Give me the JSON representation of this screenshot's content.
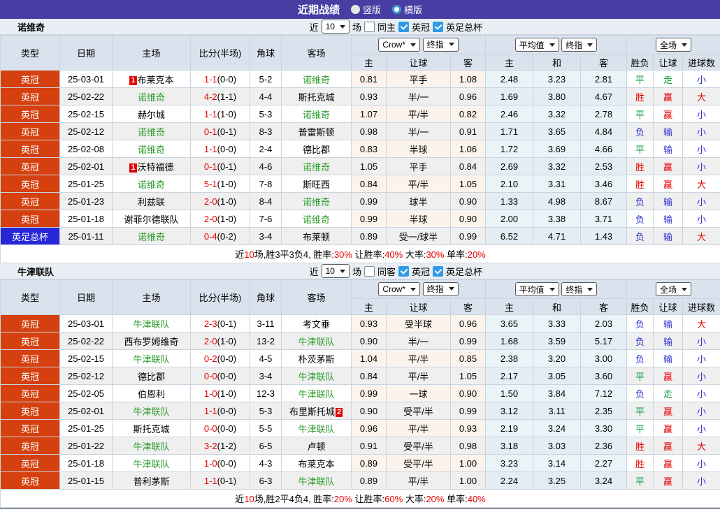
{
  "header": {
    "title": "近期战绩",
    "vertical_label": "竖版",
    "horizontal_label": "横版"
  },
  "controls": {
    "recent_label": "近",
    "games": "10",
    "games_label": "场",
    "league1": "英冠",
    "league2": "英足总杯",
    "odds_source": "Crow*",
    "odds_final": "终指",
    "avg_source": "平均值",
    "avg_final": "终指",
    "scope": "全场"
  },
  "columns": {
    "type": "类型",
    "date": "日期",
    "home": "主场",
    "score": "比分(半场)",
    "corner": "角球",
    "away": "客场",
    "odds_home": "主",
    "odds_handicap": "让球",
    "odds_away": "客",
    "avg_home": "主",
    "avg_draw": "和",
    "avg_away": "客",
    "result_wdl": "胜负",
    "result_handicap": "让球",
    "result_goals": "进球数"
  },
  "colors": {
    "accent_purple": "#473da3",
    "league_red": "#d5400e",
    "cup_blue": "#2727d8",
    "team_green": "#2f9e2f",
    "win_red": "#e60000",
    "loss_blue": "#2f2fd0",
    "draw_green": "#009933",
    "checkbox_blue": "#2e9be6"
  },
  "tables": [
    {
      "team": "诺维奇",
      "same_label": "同主",
      "summary": [
        [
          "近",
          "k"
        ],
        [
          "10",
          "r"
        ],
        [
          "场,胜3平3负4, 胜率:",
          "k"
        ],
        [
          "30%",
          "r"
        ],
        [
          " 让胜率:",
          "k"
        ],
        [
          "40%",
          "r"
        ],
        [
          " 大率:",
          "k"
        ],
        [
          "30%",
          "r"
        ],
        [
          " 单率:",
          "k"
        ],
        [
          "20%",
          "r"
        ]
      ],
      "rows": [
        {
          "league": "英冠",
          "lc": "red",
          "date": "25-03-01",
          "home": "布莱克本",
          "home_badge": "1",
          "home_team": false,
          "score": "1-1",
          "half": "(0-0)",
          "corner": "5-2",
          "away": "诺维奇",
          "away_team": true,
          "o": [
            "0.81",
            "平手",
            "1.08"
          ],
          "a": [
            "2.48",
            "3.23",
            "2.81"
          ],
          "res": [
            [
              "平",
              "g"
            ],
            [
              "走",
              "g"
            ],
            [
              "小",
              "b"
            ]
          ]
        },
        {
          "league": "英冠",
          "lc": "red",
          "date": "25-02-22",
          "home": "诺维奇",
          "home_team": true,
          "score": "4-2",
          "half": "(1-1)",
          "corner": "4-4",
          "away": "斯托克城",
          "away_team": false,
          "o": [
            "0.93",
            "半/一",
            "0.96"
          ],
          "a": [
            "1.69",
            "3.80",
            "4.67"
          ],
          "res": [
            [
              "胜",
              "r"
            ],
            [
              "赢",
              "r"
            ],
            [
              "大",
              "r"
            ]
          ]
        },
        {
          "league": "英冠",
          "lc": "red",
          "date": "25-02-15",
          "home": "赫尔城",
          "home_team": false,
          "score": "1-1",
          "half": "(1-0)",
          "corner": "5-3",
          "away": "诺维奇",
          "away_team": true,
          "o": [
            "1.07",
            "平/半",
            "0.82"
          ],
          "a": [
            "2.46",
            "3.32",
            "2.78"
          ],
          "res": [
            [
              "平",
              "g"
            ],
            [
              "赢",
              "r"
            ],
            [
              "小",
              "b"
            ]
          ]
        },
        {
          "league": "英冠",
          "lc": "red",
          "date": "25-02-12",
          "home": "诺维奇",
          "home_team": true,
          "score": "0-1",
          "half": "(0-1)",
          "corner": "8-3",
          "away": "普雷斯顿",
          "away_team": false,
          "o": [
            "0.98",
            "半/一",
            "0.91"
          ],
          "a": [
            "1.71",
            "3.65",
            "4.84"
          ],
          "res": [
            [
              "负",
              "b"
            ],
            [
              "输",
              "b"
            ],
            [
              "小",
              "b"
            ]
          ]
        },
        {
          "league": "英冠",
          "lc": "red",
          "date": "25-02-08",
          "home": "诺维奇",
          "home_team": true,
          "score": "1-1",
          "half": "(0-0)",
          "corner": "2-4",
          "away": "德比郡",
          "away_team": false,
          "o": [
            "0.83",
            "半球",
            "1.06"
          ],
          "a": [
            "1.72",
            "3.69",
            "4.66"
          ],
          "res": [
            [
              "平",
              "g"
            ],
            [
              "输",
              "b"
            ],
            [
              "小",
              "b"
            ]
          ]
        },
        {
          "league": "英冠",
          "lc": "red",
          "date": "25-02-01",
          "home": "沃特福德",
          "home_badge": "1",
          "home_team": false,
          "score": "0-1",
          "half": "(0-1)",
          "corner": "4-6",
          "away": "诺维奇",
          "away_team": true,
          "o": [
            "1.05",
            "平手",
            "0.84"
          ],
          "a": [
            "2.69",
            "3.32",
            "2.53"
          ],
          "res": [
            [
              "胜",
              "r"
            ],
            [
              "赢",
              "r"
            ],
            [
              "小",
              "b"
            ]
          ]
        },
        {
          "league": "英冠",
          "lc": "red",
          "date": "25-01-25",
          "home": "诺维奇",
          "home_team": true,
          "score": "5-1",
          "half": "(1-0)",
          "corner": "7-8",
          "away": "斯旺西",
          "away_team": false,
          "o": [
            "0.84",
            "平/半",
            "1.05"
          ],
          "a": [
            "2.10",
            "3.31",
            "3.46"
          ],
          "res": [
            [
              "胜",
              "r"
            ],
            [
              "赢",
              "r"
            ],
            [
              "大",
              "r"
            ]
          ]
        },
        {
          "league": "英冠",
          "lc": "red",
          "date": "25-01-23",
          "home": "利兹联",
          "home_team": false,
          "score": "2-0",
          "half": "(1-0)",
          "corner": "8-4",
          "away": "诺维奇",
          "away_team": true,
          "o": [
            "0.99",
            "球半",
            "0.90"
          ],
          "a": [
            "1.33",
            "4.98",
            "8.67"
          ],
          "res": [
            [
              "负",
              "b"
            ],
            [
              "输",
              "b"
            ],
            [
              "小",
              "b"
            ]
          ]
        },
        {
          "league": "英冠",
          "lc": "red",
          "date": "25-01-18",
          "home": "谢菲尔德联队",
          "home_team": false,
          "score": "2-0",
          "half": "(1-0)",
          "corner": "7-6",
          "away": "诺维奇",
          "away_team": true,
          "o": [
            "0.99",
            "半球",
            "0.90"
          ],
          "a": [
            "2.00",
            "3.38",
            "3.71"
          ],
          "res": [
            [
              "负",
              "b"
            ],
            [
              "输",
              "b"
            ],
            [
              "小",
              "b"
            ]
          ]
        },
        {
          "league": "英足总杯",
          "lc": "blue",
          "date": "25-01-11",
          "home": "诺维奇",
          "home_team": true,
          "score": "0-4",
          "half": "(0-2)",
          "corner": "3-4",
          "away": "布莱顿",
          "away_team": false,
          "o": [
            "0.89",
            "受一/球半",
            "0.99"
          ],
          "a": [
            "6.52",
            "4.71",
            "1.43"
          ],
          "res": [
            [
              "负",
              "b"
            ],
            [
              "输",
              "b"
            ],
            [
              "大",
              "r"
            ]
          ]
        }
      ]
    },
    {
      "team": "牛津联队",
      "same_label": "同客",
      "summary": [
        [
          "近",
          "k"
        ],
        [
          "10",
          "r"
        ],
        [
          "场,胜2平4负4, 胜率:",
          "k"
        ],
        [
          "20%",
          "r"
        ],
        [
          " 让胜率:",
          "k"
        ],
        [
          "60%",
          "r"
        ],
        [
          " 大率:",
          "k"
        ],
        [
          "20%",
          "r"
        ],
        [
          " 单率:",
          "k"
        ],
        [
          "40%",
          "r"
        ]
      ],
      "rows": [
        {
          "league": "英冠",
          "lc": "red",
          "date": "25-03-01",
          "home": "牛津联队",
          "home_team": true,
          "score": "2-3",
          "half": "(0-1)",
          "corner": "3-11",
          "away": "考文垂",
          "away_team": false,
          "o": [
            "0.93",
            "受半球",
            "0.96"
          ],
          "a": [
            "3.65",
            "3.33",
            "2.03"
          ],
          "res": [
            [
              "负",
              "b"
            ],
            [
              "输",
              "b"
            ],
            [
              "大",
              "r"
            ]
          ]
        },
        {
          "league": "英冠",
          "lc": "red",
          "date": "25-02-22",
          "home": "西布罗姆维奇",
          "home_team": false,
          "score": "2-0",
          "half": "(1-0)",
          "corner": "13-2",
          "away": "牛津联队",
          "away_team": true,
          "o": [
            "0.90",
            "半/一",
            "0.99"
          ],
          "a": [
            "1.68",
            "3.59",
            "5.17"
          ],
          "res": [
            [
              "负",
              "b"
            ],
            [
              "输",
              "b"
            ],
            [
              "小",
              "b"
            ]
          ]
        },
        {
          "league": "英冠",
          "lc": "red",
          "date": "25-02-15",
          "home": "牛津联队",
          "home_team": true,
          "score": "0-2",
          "half": "(0-0)",
          "corner": "4-5",
          "away": "朴茨茅斯",
          "away_team": false,
          "o": [
            "1.04",
            "平/半",
            "0.85"
          ],
          "a": [
            "2.38",
            "3.20",
            "3.00"
          ],
          "res": [
            [
              "负",
              "b"
            ],
            [
              "输",
              "b"
            ],
            [
              "小",
              "b"
            ]
          ]
        },
        {
          "league": "英冠",
          "lc": "red",
          "date": "25-02-12",
          "home": "德比郡",
          "home_team": false,
          "score": "0-0",
          "half": "(0-0)",
          "corner": "3-4",
          "away": "牛津联队",
          "away_team": true,
          "o": [
            "0.84",
            "平/半",
            "1.05"
          ],
          "a": [
            "2.17",
            "3.05",
            "3.60"
          ],
          "res": [
            [
              "平",
              "g"
            ],
            [
              "赢",
              "r"
            ],
            [
              "小",
              "b"
            ]
          ]
        },
        {
          "league": "英冠",
          "lc": "red",
          "date": "25-02-05",
          "home": "伯恩利",
          "home_team": false,
          "score": "1-0",
          "half": "(1-0)",
          "corner": "12-3",
          "away": "牛津联队",
          "away_team": true,
          "o": [
            "0.99",
            "一球",
            "0.90"
          ],
          "a": [
            "1.50",
            "3.84",
            "7.12"
          ],
          "res": [
            [
              "负",
              "b"
            ],
            [
              "走",
              "g"
            ],
            [
              "小",
              "b"
            ]
          ]
        },
        {
          "league": "英冠",
          "lc": "red",
          "date": "25-02-01",
          "home": "牛津联队",
          "home_team": true,
          "score": "1-1",
          "half": "(0-0)",
          "corner": "5-3",
          "away": "布里斯托城",
          "away_badge": "2",
          "away_team": false,
          "o": [
            "0.90",
            "受平/半",
            "0.99"
          ],
          "a": [
            "3.12",
            "3.11",
            "2.35"
          ],
          "res": [
            [
              "平",
              "g"
            ],
            [
              "赢",
              "r"
            ],
            [
              "小",
              "b"
            ]
          ]
        },
        {
          "league": "英冠",
          "lc": "red",
          "date": "25-01-25",
          "home": "斯托克城",
          "home_team": false,
          "score": "0-0",
          "half": "(0-0)",
          "corner": "5-5",
          "away": "牛津联队",
          "away_team": true,
          "o": [
            "0.96",
            "平/半",
            "0.93"
          ],
          "a": [
            "2.19",
            "3.24",
            "3.30"
          ],
          "res": [
            [
              "平",
              "g"
            ],
            [
              "赢",
              "r"
            ],
            [
              "小",
              "b"
            ]
          ]
        },
        {
          "league": "英冠",
          "lc": "red",
          "date": "25-01-22",
          "home": "牛津联队",
          "home_team": true,
          "score": "3-2",
          "half": "(1-2)",
          "corner": "6-5",
          "away": "卢顿",
          "away_team": false,
          "o": [
            "0.91",
            "受平/半",
            "0.98"
          ],
          "a": [
            "3.18",
            "3.03",
            "2.36"
          ],
          "res": [
            [
              "胜",
              "r"
            ],
            [
              "赢",
              "r"
            ],
            [
              "大",
              "r"
            ]
          ]
        },
        {
          "league": "英冠",
          "lc": "red",
          "date": "25-01-18",
          "home": "牛津联队",
          "home_team": true,
          "score": "1-0",
          "half": "(0-0)",
          "corner": "4-3",
          "away": "布莱克本",
          "away_team": false,
          "o": [
            "0.89",
            "受平/半",
            "1.00"
          ],
          "a": [
            "3.23",
            "3.14",
            "2.27"
          ],
          "res": [
            [
              "胜",
              "r"
            ],
            [
              "赢",
              "r"
            ],
            [
              "小",
              "b"
            ]
          ]
        },
        {
          "league": "英冠",
          "lc": "red",
          "date": "25-01-15",
          "home": "普利茅斯",
          "home_team": false,
          "score": "1-1",
          "half": "(0-1)",
          "corner": "6-3",
          "away": "牛津联队",
          "away_team": true,
          "o": [
            "0.89",
            "平/半",
            "1.00"
          ],
          "a": [
            "2.24",
            "3.25",
            "3.24"
          ],
          "res": [
            [
              "平",
              "g"
            ],
            [
              "赢",
              "r"
            ],
            [
              "小",
              "b"
            ]
          ]
        }
      ]
    }
  ]
}
